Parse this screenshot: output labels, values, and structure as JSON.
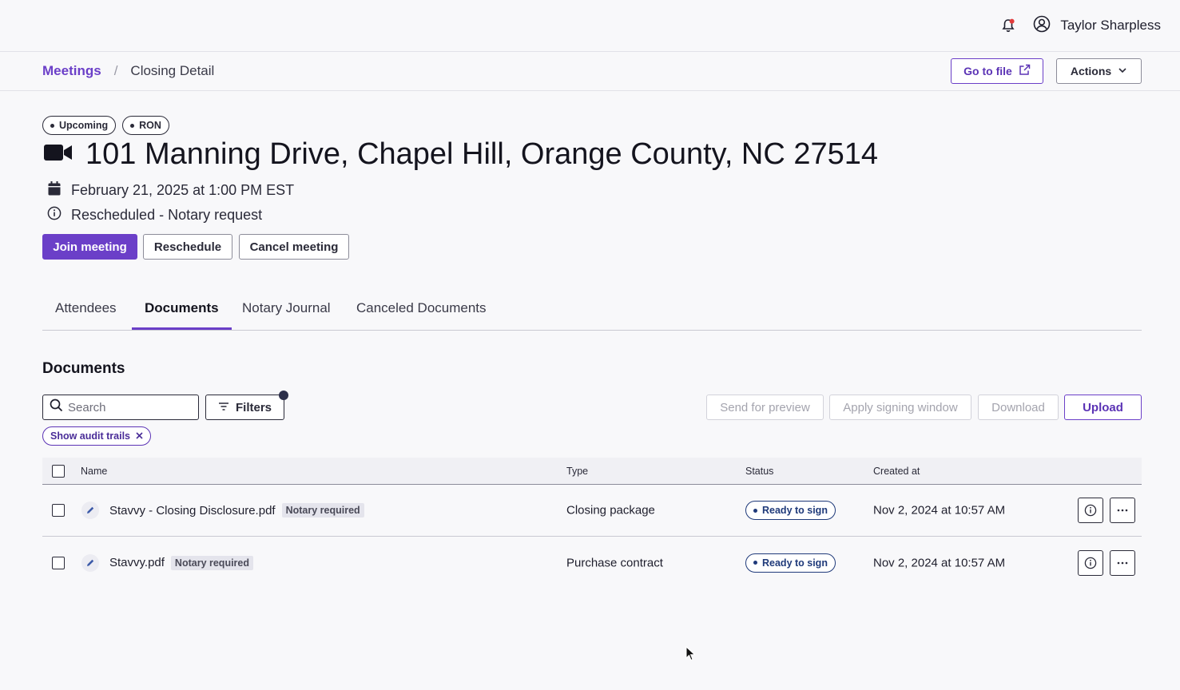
{
  "header": {
    "user_name": "Taylor Sharpless",
    "bell_icon": "bell-icon",
    "user_icon": "user-circle-icon"
  },
  "breadcrumb": {
    "root": "Meetings",
    "separator": "/",
    "current": "Closing Detail"
  },
  "top_actions": {
    "go_to_file": "Go to file",
    "actions": "Actions"
  },
  "meeting": {
    "badges": [
      "Upcoming",
      "RON"
    ],
    "title": "101 Manning Drive, Chapel Hill, Orange County, NC 27514",
    "date": "February 21, 2025 at 1:00 PM EST",
    "note": "Rescheduled - Notary request",
    "buttons": {
      "join": "Join meeting",
      "reschedule": "Reschedule",
      "cancel": "Cancel meeting"
    }
  },
  "tabs": [
    {
      "label": "Attendees",
      "active": false
    },
    {
      "label": "Documents",
      "active": true
    },
    {
      "label": "Notary Journal",
      "active": false
    },
    {
      "label": "Canceled Documents",
      "active": false
    }
  ],
  "documents": {
    "section_title": "Documents",
    "search_placeholder": "Search",
    "filters_label": "Filters",
    "active_filter": "Show audit trails",
    "toolbar": {
      "send_for_preview": "Send for preview",
      "apply_signing_window": "Apply signing window",
      "download": "Download",
      "upload": "Upload"
    },
    "columns": [
      "Name",
      "Type",
      "Status",
      "Created at"
    ],
    "rows": [
      {
        "name": "Stavvy - Closing Disclosure.pdf",
        "tag": "Notary required",
        "type": "Closing package",
        "status": "Ready to sign",
        "created_at": "Nov 2, 2024 at 10:57 AM"
      },
      {
        "name": "Stavvy.pdf",
        "tag": "Notary required",
        "type": "Purchase contract",
        "status": "Ready to sign",
        "created_at": "Nov 2, 2024 at 10:57 AM"
      }
    ]
  },
  "colors": {
    "accent": "#6b3fc8",
    "status_blue": "#1f3a7a",
    "notification_red": "#e23b3b"
  }
}
